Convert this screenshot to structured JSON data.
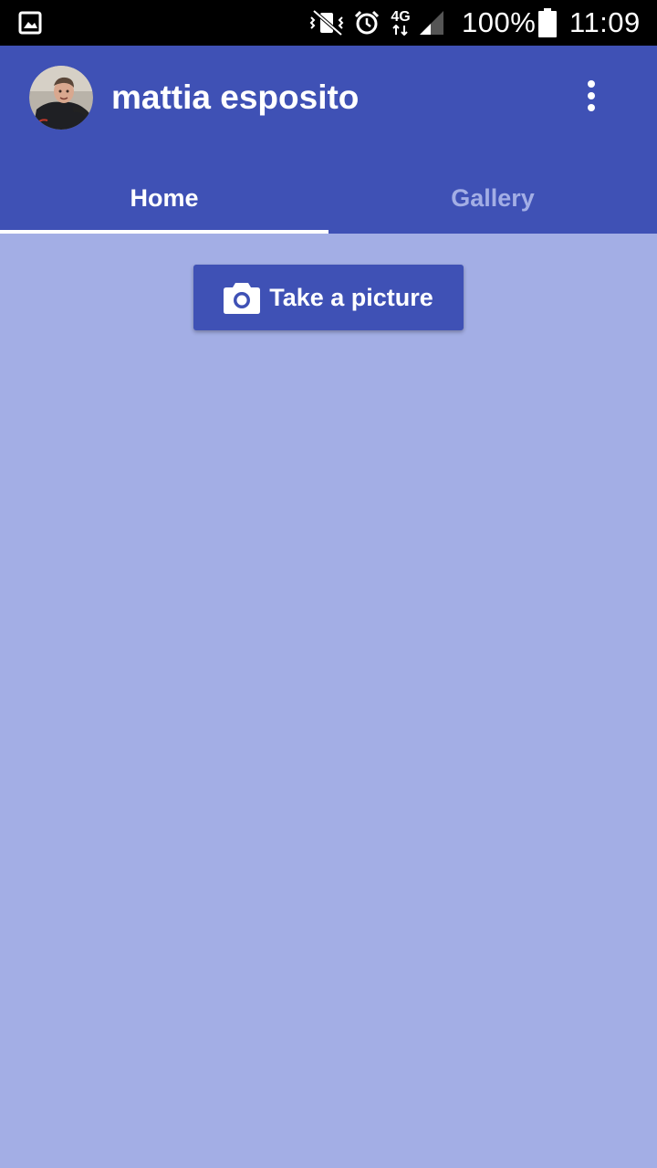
{
  "status_bar": {
    "icons": [
      "gallery-notification-icon",
      "vibrate-mute-icon",
      "alarm-icon",
      "network-4g-icon",
      "signal-icon",
      "battery-icon"
    ],
    "network_type": "4G",
    "battery": "100%",
    "time": "11:09"
  },
  "app_bar": {
    "user_name": "mattia esposito",
    "avatar_icon": "avatar",
    "overflow_icon": "more-vert-icon",
    "color": "#3f51b5"
  },
  "tabs": [
    {
      "label": "Home",
      "selected": true
    },
    {
      "label": "Gallery",
      "selected": false
    }
  ],
  "main": {
    "take_picture_label": "Take a picture",
    "take_picture_icon": "camera-icon",
    "background": "#a3aee5"
  }
}
